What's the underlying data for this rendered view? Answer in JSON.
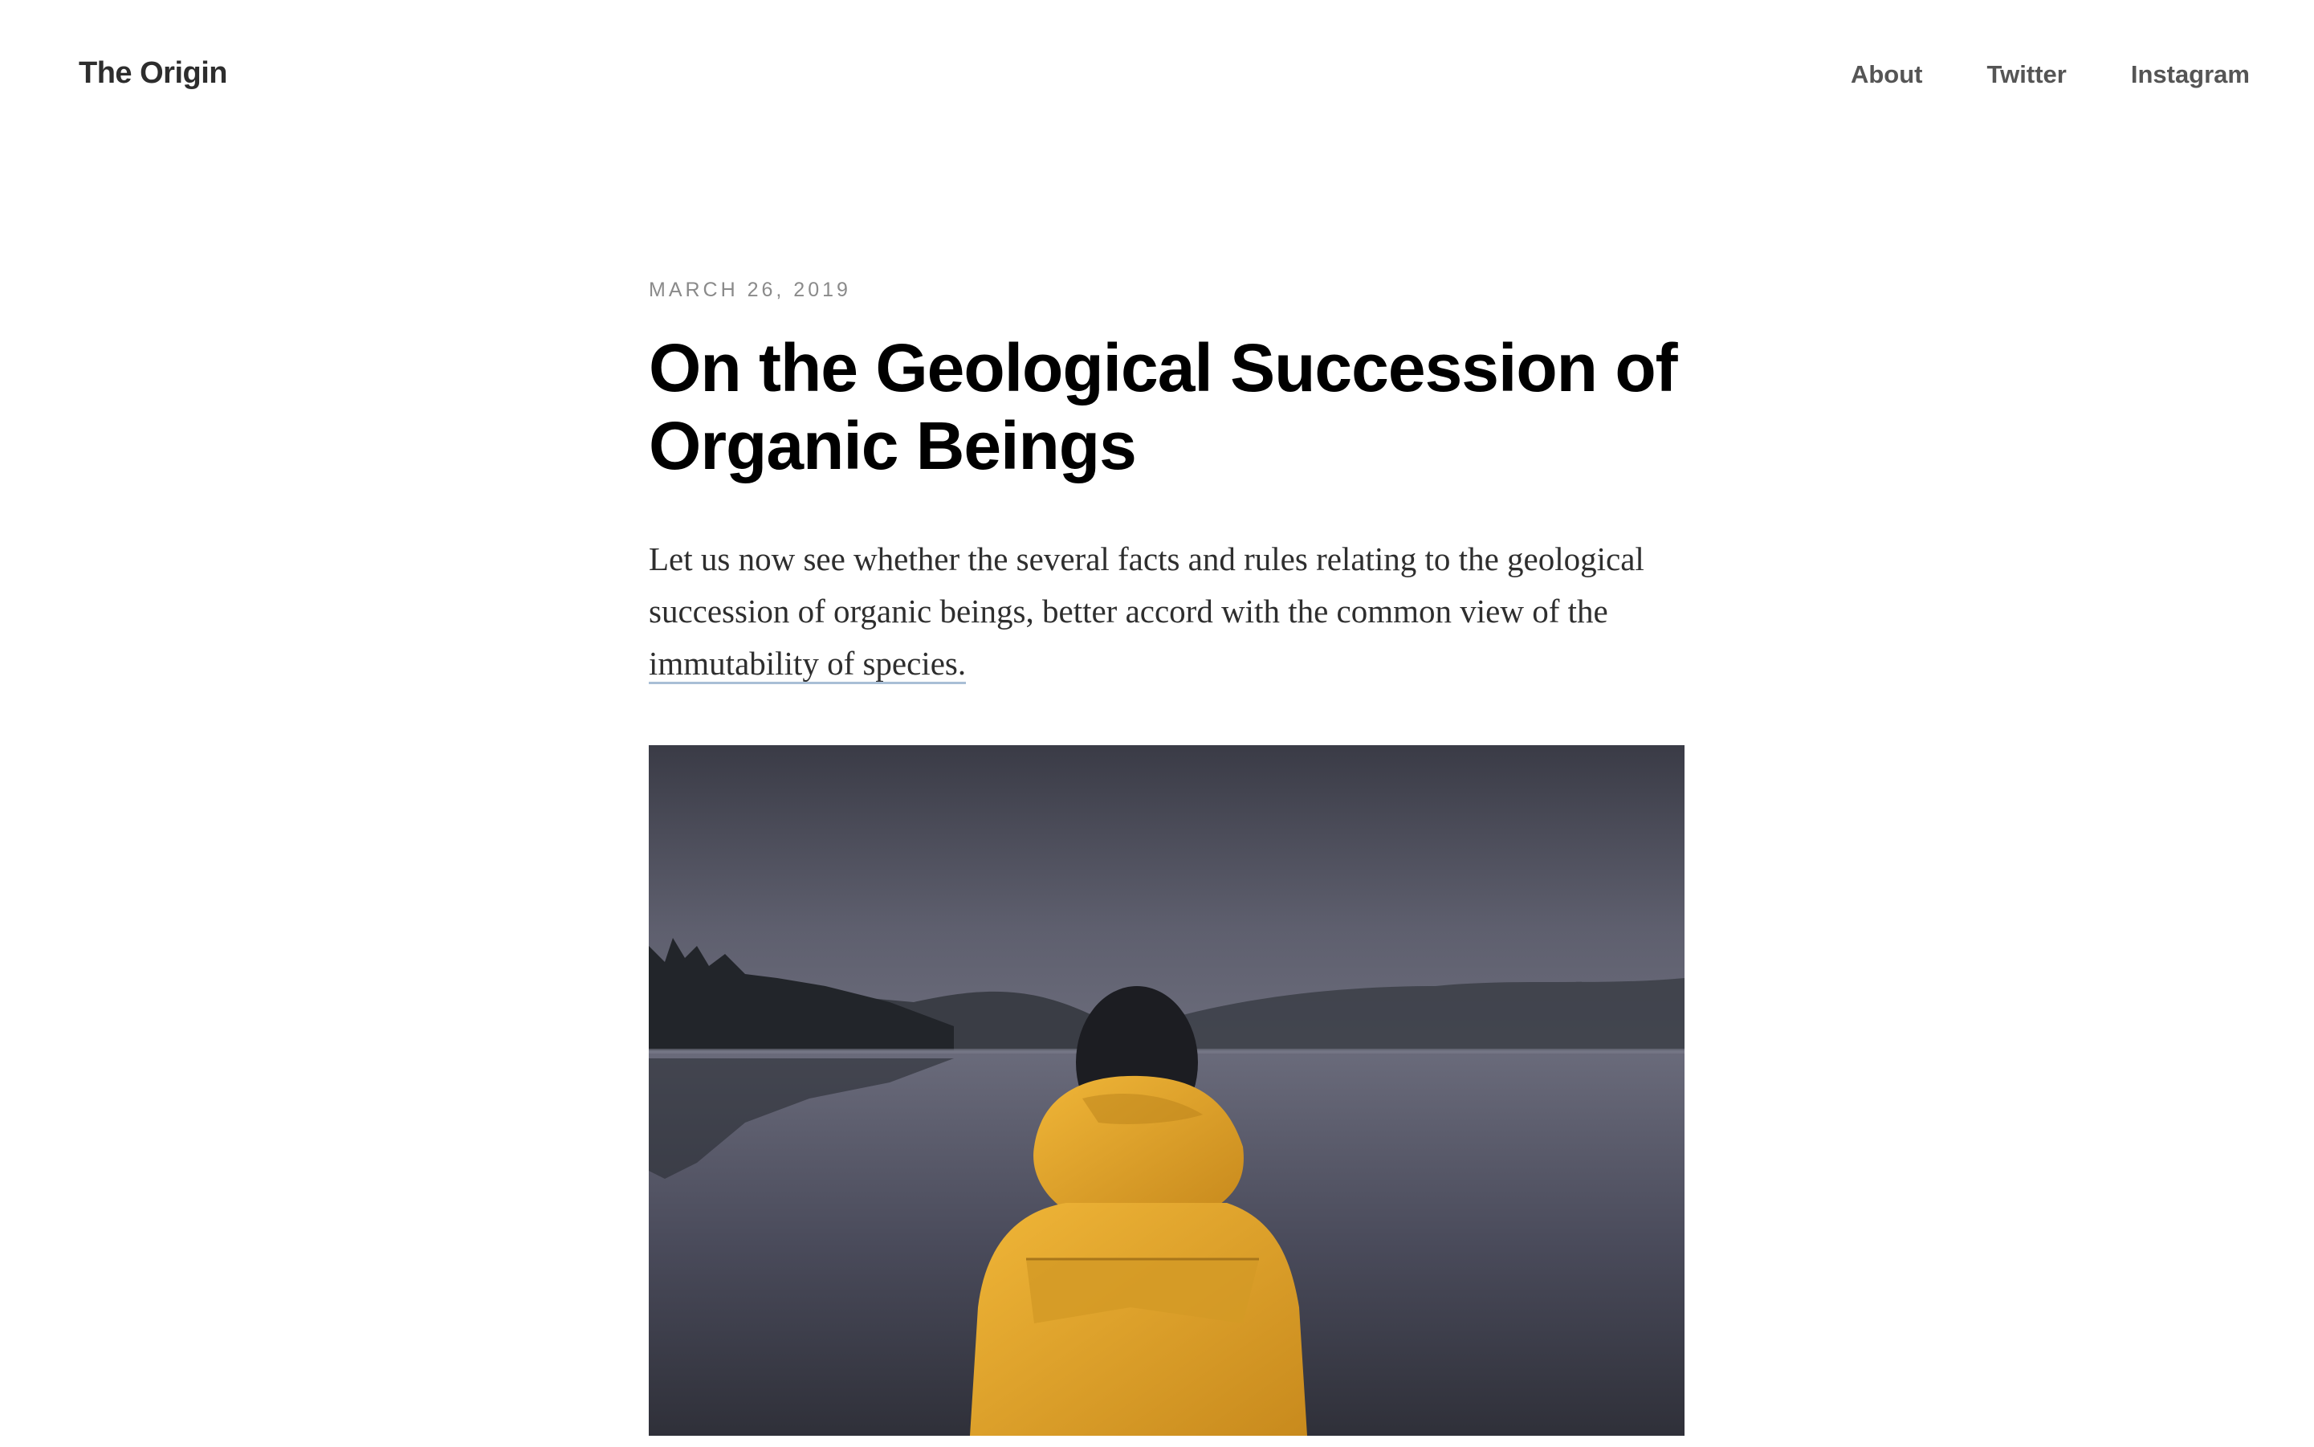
{
  "site": {
    "logo": "The Origin"
  },
  "nav": {
    "items": [
      "About",
      "Twitter",
      "Instagram"
    ]
  },
  "post": {
    "date": "March 26, 2019",
    "title": "On the Geological Succession of Organic Beings",
    "excerpt_text": "Let us now see whether the several facts and rules relating to the geological succession of organic beings, better accord with the common view of the ",
    "excerpt_link": "immutability of species."
  },
  "hero": {
    "description": "person-in-yellow-raincoat-facing-lake-icon",
    "colors": {
      "sky": "#3b3c48",
      "water": "#55566a",
      "jacket": "#e2a52a",
      "treeline": "#23262b"
    }
  }
}
